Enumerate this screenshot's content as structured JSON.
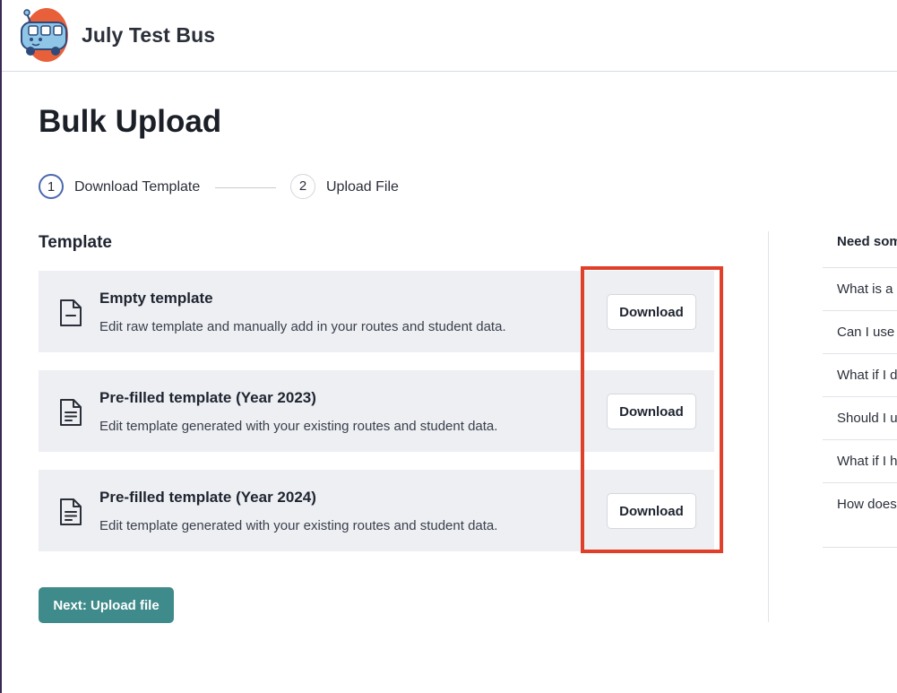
{
  "header": {
    "app_title": "July Test Bus",
    "logo_icon": "bus-mascot-icon"
  },
  "page": {
    "title": "Bulk Upload"
  },
  "stepper": {
    "steps": [
      {
        "number": "1",
        "label": "Download Template",
        "active": true
      },
      {
        "number": "2",
        "label": "Upload File",
        "active": false
      }
    ]
  },
  "template_section": {
    "title": "Template",
    "cards": [
      {
        "title": "Empty template",
        "description": "Edit raw template and manually add in your routes and student data.",
        "button_label": "Download",
        "icon": "empty-document-icon"
      },
      {
        "title": "Pre-filled template (Year 2023)",
        "description": "Edit template generated with your existing routes and student data.",
        "button_label": "Download",
        "icon": "filled-document-icon"
      },
      {
        "title": "Pre-filled template (Year 2024)",
        "description": "Edit template generated with your existing routes and student data.",
        "button_label": "Download",
        "icon": "filled-document-icon"
      }
    ],
    "next_button_label": "Next: Upload file"
  },
  "faq": {
    "heading": "Need som",
    "items": [
      "What is a",
      "Can I use",
      "What if I d",
      "Should I u",
      "What if I h",
      "How does data in the"
    ]
  },
  "colors": {
    "accent_teal": "#3f8a8a",
    "highlight_red": "#e0402a",
    "active_step_blue": "#4a68b0",
    "card_background": "#edeff3",
    "logo_orange": "#e8603a",
    "logo_blue": "#8fc6e8"
  }
}
